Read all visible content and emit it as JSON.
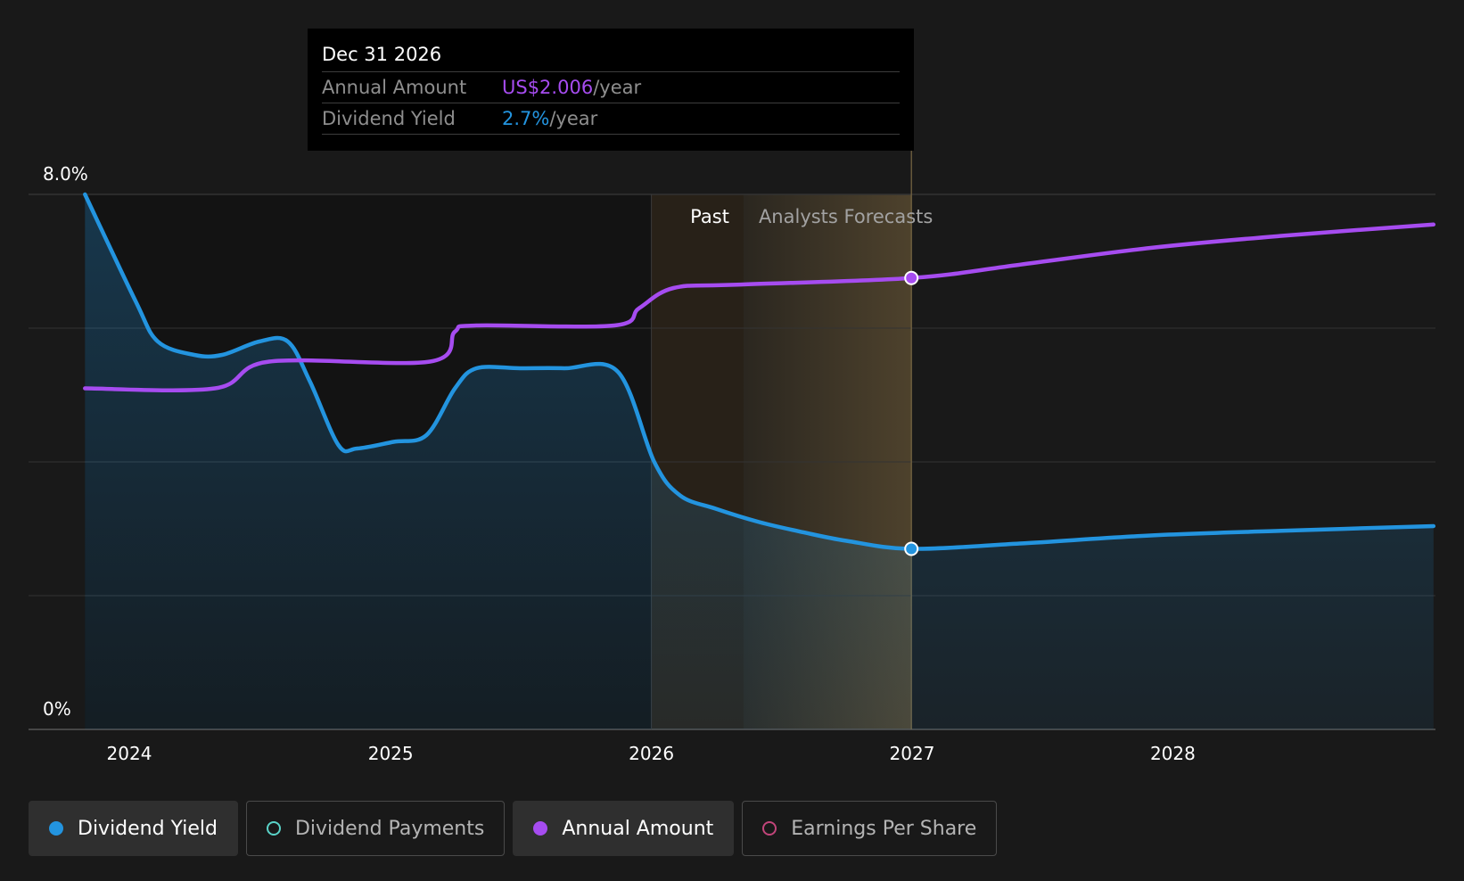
{
  "tooltip": {
    "date": "Dec 31 2026",
    "rows": [
      {
        "label": "Annual Amount",
        "value": "US$2.006",
        "unit": "/year",
        "color": "#a64cf0"
      },
      {
        "label": "Dividend Yield",
        "value": "2.7%",
        "unit": "/year",
        "color": "#2394df"
      }
    ]
  },
  "legend": [
    {
      "label": "Dividend Yield",
      "color": "#2394df",
      "filled": true,
      "active": true
    },
    {
      "label": "Dividend Payments",
      "color": "#5ad3c8",
      "filled": false,
      "active": false
    },
    {
      "label": "Annual Amount",
      "color": "#a64cf0",
      "filled": true,
      "active": true
    },
    {
      "label": "Earnings Per Share",
      "color": "#c2457a",
      "filled": false,
      "active": false
    }
  ],
  "chart_data": {
    "type": "line",
    "x_range": [
      "2023-10-31",
      "2028-12-31"
    ],
    "y_range": [
      0,
      8.0
    ],
    "y_tick_labels": [
      "0%",
      "8.0%"
    ],
    "x_tick_labels": [
      "2024",
      "2025",
      "2026",
      "2027",
      "2028"
    ],
    "past_label": "Past",
    "forecast_label": "Analysts Forecasts",
    "past_start": "2026-01-01",
    "forecast_start": "2026-05-10",
    "today": "2026-12-31",
    "series": [
      {
        "name": "Dividend Yield",
        "color": "#2394df",
        "area": true,
        "points": [
          [
            "2023-10-31",
            8.0
          ],
          [
            "2024-01-10",
            6.4
          ],
          [
            "2024-02-10",
            5.8
          ],
          [
            "2024-04-01",
            5.6
          ],
          [
            "2024-05-10",
            5.6
          ],
          [
            "2024-07-01",
            5.8
          ],
          [
            "2024-08-10",
            5.8
          ],
          [
            "2024-09-10",
            5.2
          ],
          [
            "2024-10-20",
            4.25
          ],
          [
            "2024-11-15",
            4.2
          ],
          [
            "2025-01-05",
            4.3
          ],
          [
            "2025-02-20",
            4.4
          ],
          [
            "2025-04-01",
            5.1
          ],
          [
            "2025-05-01",
            5.4
          ],
          [
            "2025-07-01",
            5.4
          ],
          [
            "2025-09-01",
            5.4
          ],
          [
            "2025-11-15",
            5.35
          ],
          [
            "2026-01-05",
            4.0
          ],
          [
            "2026-02-10",
            3.5
          ],
          [
            "2026-04-01",
            3.3
          ],
          [
            "2026-06-01",
            3.1
          ],
          [
            "2026-08-01",
            2.95
          ],
          [
            "2026-10-01",
            2.82
          ],
          [
            "2026-12-31",
            2.7
          ],
          [
            "2027-06-01",
            2.78
          ],
          [
            "2027-12-01",
            2.9
          ],
          [
            "2028-06-01",
            2.97
          ],
          [
            "2028-12-31",
            3.04
          ]
        ]
      },
      {
        "name": "Annual Amount",
        "color": "#a64cf0",
        "area": false,
        "points": [
          [
            "2023-10-31",
            5.1
          ],
          [
            "2024-04-30",
            5.1
          ],
          [
            "2024-07-15",
            5.5
          ],
          [
            "2025-02-25",
            5.5
          ],
          [
            "2025-04-01",
            5.95
          ],
          [
            "2025-05-01",
            6.04
          ],
          [
            "2025-11-10",
            6.04
          ],
          [
            "2025-12-15",
            6.3
          ],
          [
            "2026-02-01",
            6.6
          ],
          [
            "2026-05-01",
            6.65
          ],
          [
            "2026-12-31",
            6.75
          ],
          [
            "2027-06-01",
            6.95
          ],
          [
            "2027-12-01",
            7.2
          ],
          [
            "2028-06-01",
            7.38
          ],
          [
            "2028-12-31",
            7.55
          ]
        ]
      }
    ]
  }
}
